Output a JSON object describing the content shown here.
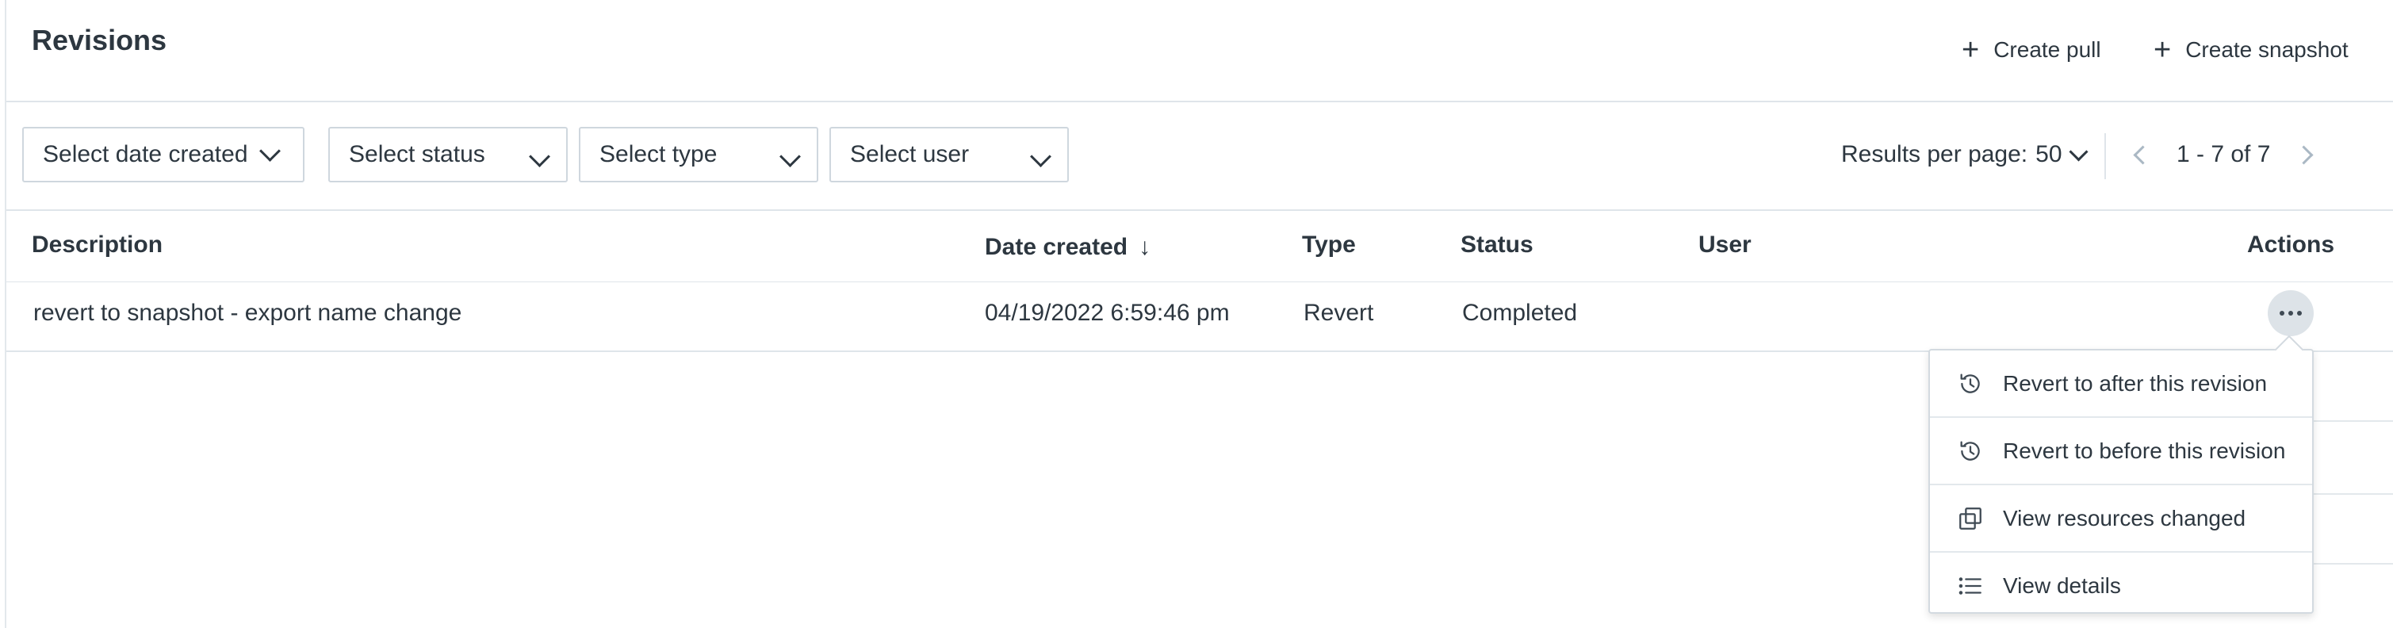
{
  "header": {
    "title": "Revisions",
    "create_pull": "Create pull",
    "create_snapshot": "Create snapshot"
  },
  "filters": {
    "date_created": "Select date created",
    "status": "Select status",
    "type": "Select type",
    "user": "Select user"
  },
  "pagination": {
    "results_per_page_label": "Results per page:",
    "results_per_page_value": "50",
    "range": "1 - 7 of 7"
  },
  "table": {
    "columns": {
      "description": "Description",
      "date_created": "Date created",
      "type": "Type",
      "status": "Status",
      "user": "User",
      "actions": "Actions"
    },
    "rows": [
      {
        "description": "revert to snapshot - export name change",
        "date_created": "04/19/2022 6:59:46 pm",
        "type": "Revert",
        "status": "Completed",
        "user": ""
      }
    ]
  },
  "actions_menu": {
    "items": [
      {
        "label": "Revert to after this revision",
        "icon": "history-icon"
      },
      {
        "label": "Revert to before this revision",
        "icon": "history-icon"
      },
      {
        "label": "View resources changed",
        "icon": "copy-icon"
      },
      {
        "label": "View details",
        "icon": "list-icon"
      }
    ]
  }
}
